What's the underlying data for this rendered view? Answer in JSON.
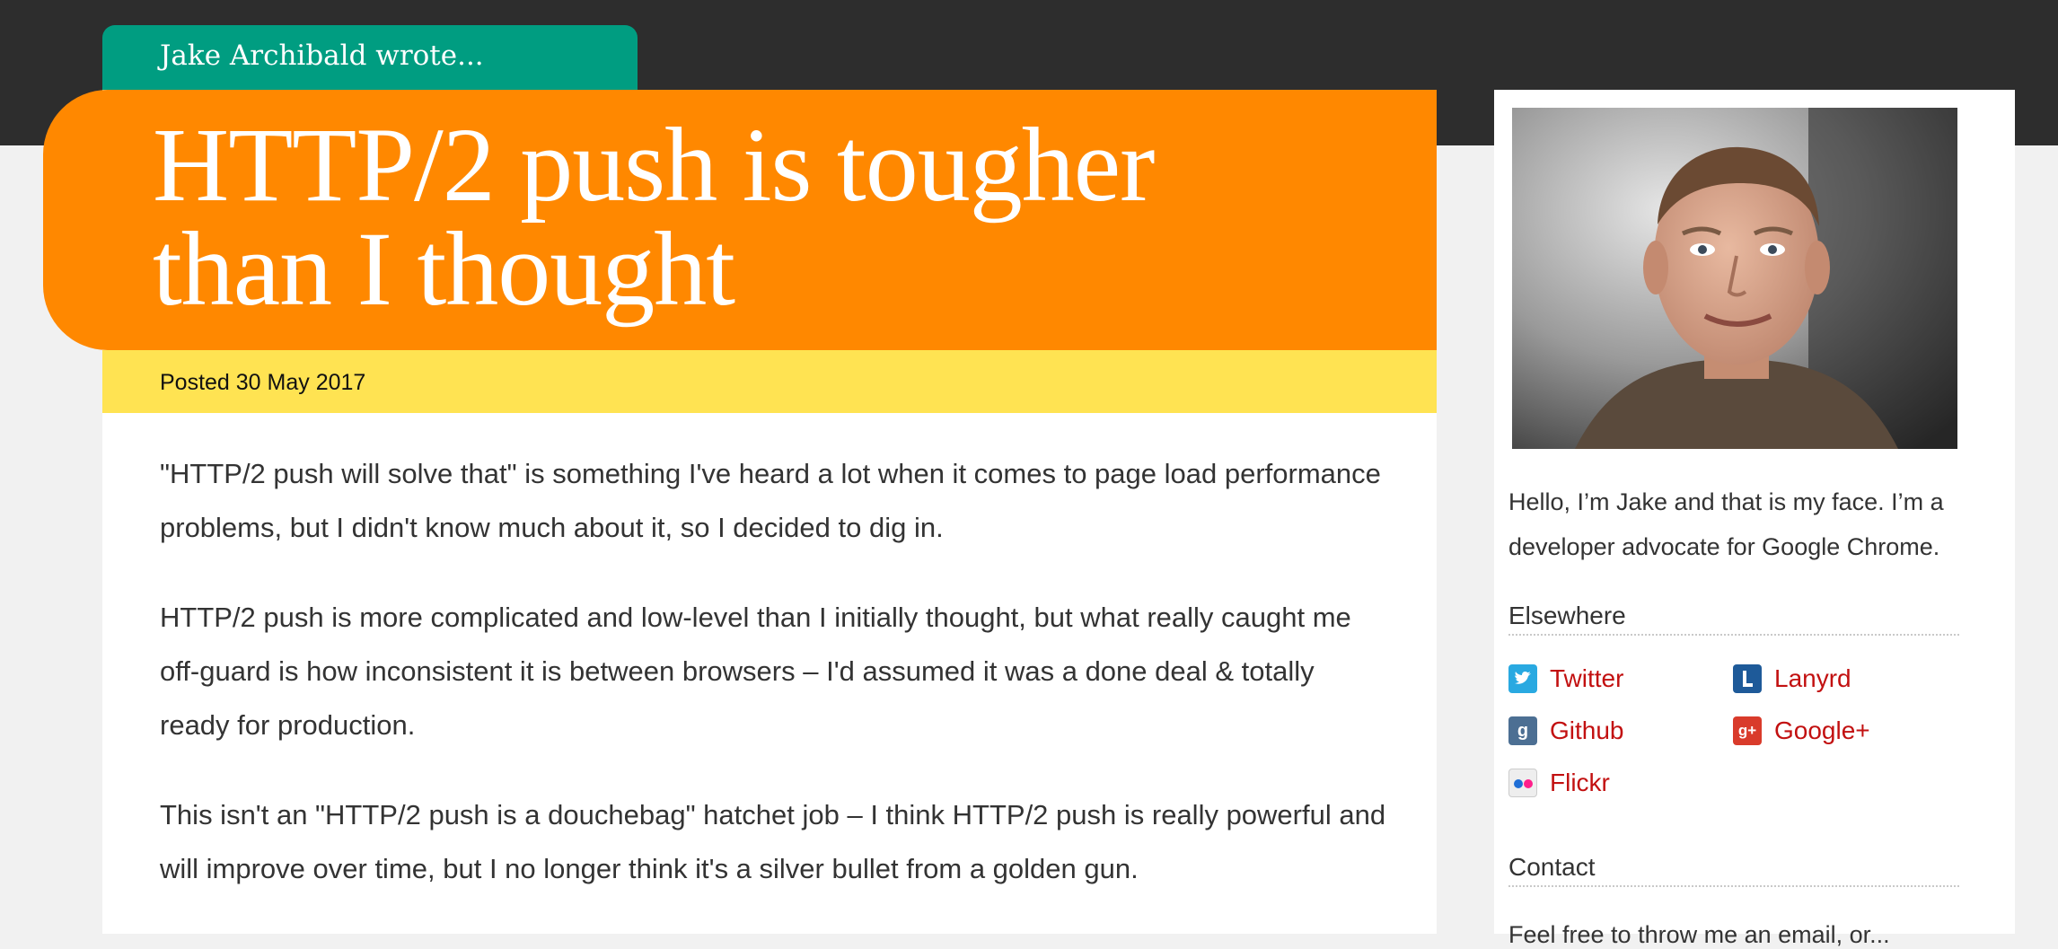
{
  "author_tab": "Jake Archibald wrote...",
  "title_lines": [
    "HTTP/2 push is tougher",
    "than I thought"
  ],
  "posted": "Posted 30 May 2017",
  "article": {
    "paragraphs": [
      "\"HTTP/2 push will solve that\" is something I've heard a lot when it comes to page load performance problems, but I didn't know much about it, so I decided to dig in.",
      "HTTP/2 push is more complicated and low-level than I initially thought, but what really caught me off-guard is how inconsistent it is between browsers – I'd assumed it was a done deal & totally ready for production.",
      "This isn't an \"HTTP/2 push is a douchebag\" hatchet job – I think HTTP/2 push is really powerful and will improve over time, but I no longer think it's a silver bullet from a golden gun."
    ]
  },
  "sidebar": {
    "bio": "Hello, I’m Jake and that is my face. I’m a developer advocate for Google Chrome.",
    "elsewhere_title": "Elsewhere",
    "links": [
      {
        "label": "Twitter",
        "icon": "twitter-icon"
      },
      {
        "label": "Lanyrd",
        "icon": "lanyrd-icon"
      },
      {
        "label": "Github",
        "icon": "github-icon"
      },
      {
        "label": "Google+",
        "icon": "google-plus-icon"
      },
      {
        "label": "Flickr",
        "icon": "flickr-icon"
      }
    ],
    "contact_title": "Contact",
    "contact_text": "Feel free to throw me an email, or..."
  },
  "colors": {
    "topbar": "#2d2d2d",
    "author_tab": "#009d81",
    "title_block": "#ff8800",
    "posted_bar": "#ffe352",
    "link": "#c21010"
  }
}
